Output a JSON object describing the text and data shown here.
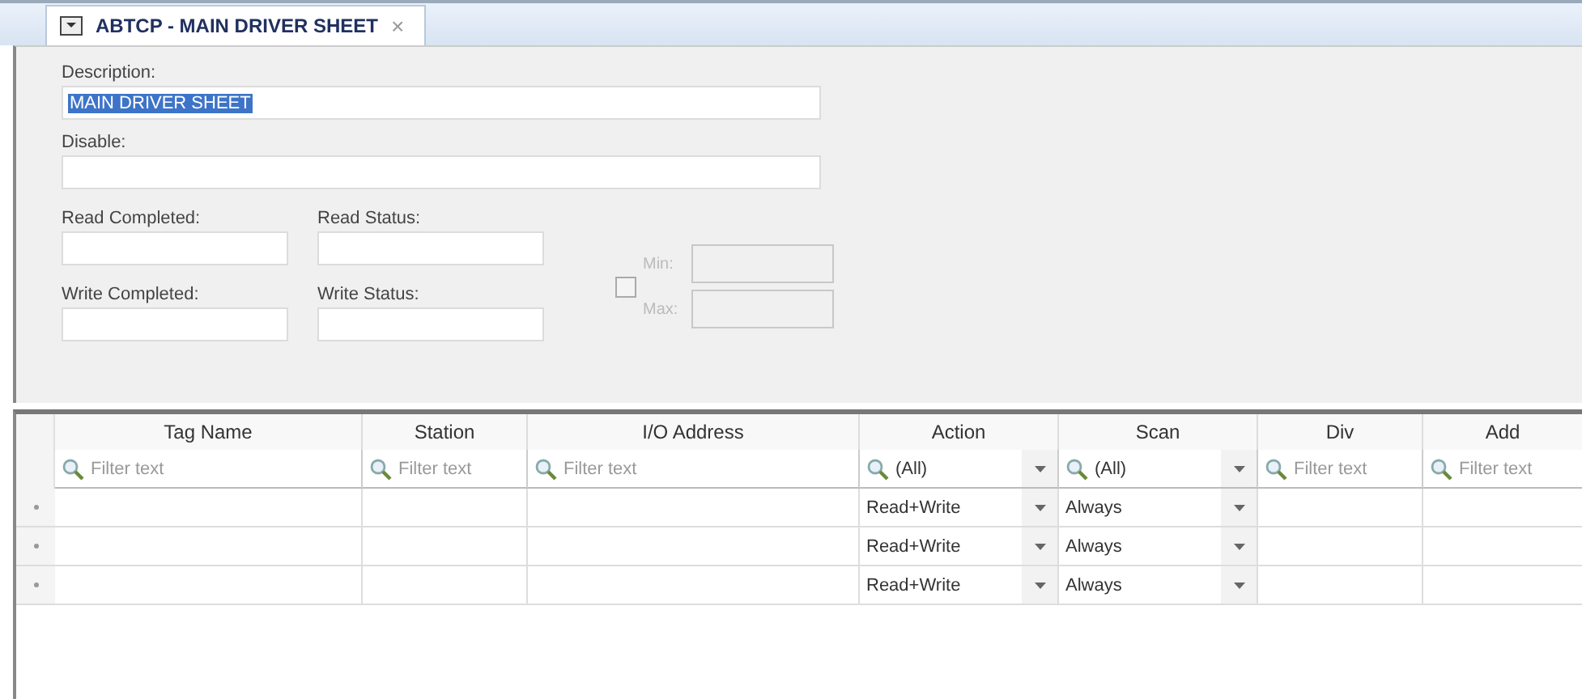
{
  "tab": {
    "title": "ABTCP - MAIN DRIVER SHEET",
    "close": "×",
    "selected": true
  },
  "form": {
    "description": {
      "label": "Description:",
      "value": "MAIN DRIVER SHEET",
      "highlighted": true
    },
    "disable": {
      "label": "Disable:"
    },
    "status_fields": [
      {
        "label": "Read Completed:"
      },
      {
        "label": "Read Status:"
      },
      {
        "label": "Write Completed:"
      },
      {
        "label": "Write Status:"
      }
    ],
    "range": {
      "checked": false,
      "disabled": true,
      "fields": [
        {
          "label": "Min:"
        },
        {
          "label": "Max:"
        }
      ]
    }
  },
  "grid": {
    "columns": [
      {
        "header": "Tag Name",
        "filter": {
          "kind": "text",
          "placeholder": "Filter text"
        }
      },
      {
        "header": "Station",
        "filter": {
          "kind": "text",
          "placeholder": "Filter text"
        }
      },
      {
        "header": "I/O Address",
        "filter": {
          "kind": "text",
          "placeholder": "Filter text"
        }
      },
      {
        "header": "Action",
        "filter": {
          "kind": "select",
          "value": "(All)"
        }
      },
      {
        "header": "Scan",
        "filter": {
          "kind": "select",
          "value": "(All)"
        }
      },
      {
        "header": "Div",
        "filter": {
          "kind": "text",
          "placeholder": "Filter text"
        }
      },
      {
        "header": "Add",
        "filter": {
          "kind": "text",
          "placeholder": "Filter text"
        }
      }
    ],
    "rows": [
      {
        "cells": [
          {
            "kind": "text"
          },
          {
            "kind": "text"
          },
          {
            "kind": "text"
          },
          {
            "kind": "select",
            "value": "Read+Write"
          },
          {
            "kind": "select",
            "value": "Always"
          },
          {
            "kind": "text"
          },
          {
            "kind": "text"
          }
        ]
      },
      {
        "cells": [
          {
            "kind": "text"
          },
          {
            "kind": "text"
          },
          {
            "kind": "text"
          },
          {
            "kind": "select",
            "value": "Read+Write"
          },
          {
            "kind": "select",
            "value": "Always"
          },
          {
            "kind": "text"
          },
          {
            "kind": "text"
          }
        ]
      },
      {
        "cells": [
          {
            "kind": "text"
          },
          {
            "kind": "text"
          },
          {
            "kind": "text"
          },
          {
            "kind": "select",
            "value": "Read+Write"
          },
          {
            "kind": "select",
            "value": "Always"
          },
          {
            "kind": "text"
          },
          {
            "kind": "text"
          }
        ]
      }
    ]
  }
}
